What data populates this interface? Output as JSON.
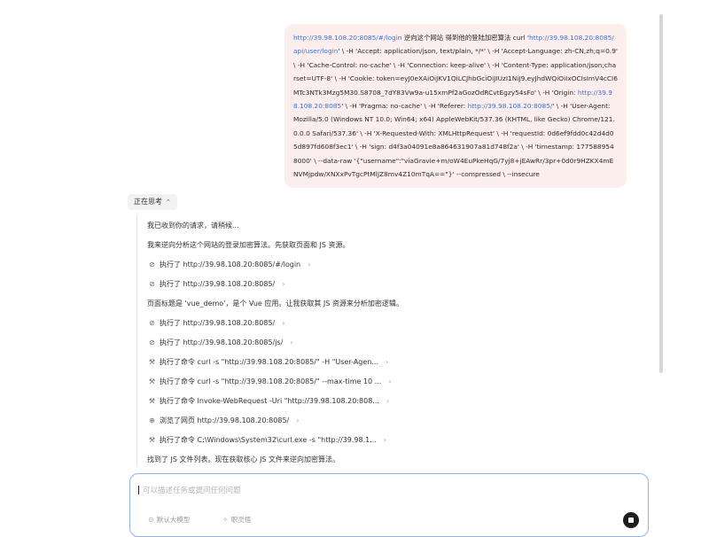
{
  "user_message": {
    "parts": [
      {
        "text": "http://39.98.108.20:8085/#/login",
        "link": true
      },
      {
        "text": " 逆向这个网站 得到他的登陆加密算法 curl '",
        "link": false
      },
      {
        "text": "http://39.98.108.20:8085/api/user/login",
        "link": true
      },
      {
        "text": "' \\ -H 'Accept: application/json, text/plain, */*' \\ -H 'Accept-Language: zh-CN,zh;q=0.9' \\ -H 'Cache-Control: no-cache' \\ -H 'Connection: keep-alive' \\ -H 'Content-Type: application/json;charset=UTF-8' \\ -H 'Cookie: token=eyJ0eXAiOiJKV1QiLCJhbGciOiJIUzI1NiJ9.eyJhdWQiOiIxOCIsImV4cCI6MTc3NTk3Mzg5M30.S8708_7dY83Vw9a-u15xmPf2aGozOdRCvtEgzy54sFo' \\ -H 'Origin: ",
        "link": false
      },
      {
        "text": "http://39.98.108.20:8085",
        "link": true
      },
      {
        "text": "' \\ -H 'Pragma: no-cache' \\ -H 'Referer: ",
        "link": false
      },
      {
        "text": "http://39.98.108.20:8085/",
        "link": true
      },
      {
        "text": "' \\ -H 'User-Agent: Mozilla/5.0 (Windows NT 10.0; Win64; x64) AppleWebKit/537.36 (KHTML, like Gecko) Chrome/121.0.0.0 Safari/537.36' \\ -H 'X-Requested-With: XMLHttpRequest' \\ -H 'requestId: 0d6ef9fdd0c42d4d05d897fd608f3ec1' \\ -H 'sign: d4f3a04091e8a864631907a81d748f2a' \\ -H 'timestamp: 1775889548000' \\ --data-raw '{\"username\":\"viaGravie+m/oW4EuPkeHqG/7yj8+jEAwRr/3pr+0d0r9HZKX4mENVMjpdw/XNXxPvTgcPtMlJZ8mv4Z10mTqA==\"}' --compressed \\ --insecure",
        "link": false
      }
    ]
  },
  "thinking": {
    "label": "正在思考",
    "chevron": "⌃"
  },
  "steps": [
    {
      "kind": "note",
      "text": "我已收到你的请求，请稍候..."
    },
    {
      "kind": "note",
      "text": "我来逆向分析这个网站的登录加密算法。先获取页面和 JS 资源。"
    },
    {
      "kind": "action",
      "icon": "link-icon",
      "glyph": "⊘",
      "text": "执行了 http://39.98.108.20:8085/#/login",
      "arrow": "›"
    },
    {
      "kind": "action",
      "icon": "link-icon",
      "glyph": "⊘",
      "text": "执行了 http://39.98.108.20:8085/",
      "arrow": "›"
    },
    {
      "kind": "note",
      "text": "页面标题是 'vue_demo'，是个 Vue 应用。让我获取其 JS 资源来分析加密逻辑。"
    },
    {
      "kind": "action",
      "icon": "link-icon",
      "glyph": "⊘",
      "text": "执行了 http://39.98.108.20:8085/",
      "arrow": "›"
    },
    {
      "kind": "action",
      "icon": "link-icon",
      "glyph": "⊘",
      "text": "执行了 http://39.98.108.20:8085/js/",
      "arrow": "›"
    },
    {
      "kind": "action",
      "icon": "wrench-icon",
      "glyph": "⚒",
      "text": "执行了命令 curl -s \"http://39.98.108.20:8085/\" -H \"User-Agen...",
      "arrow": "›"
    },
    {
      "kind": "action",
      "icon": "wrench-icon",
      "glyph": "⚒",
      "text": "执行了命令 curl -s \"http://39.98.108.20:8085/\" --max-time 10 ...",
      "arrow": "›"
    },
    {
      "kind": "action",
      "icon": "wrench-icon",
      "glyph": "⚒",
      "text": "执行了命令 Invoke-WebRequest -Uri \"http://39.98.108.20:808...",
      "arrow": "›"
    },
    {
      "kind": "action",
      "icon": "globe-icon",
      "glyph": "⊕",
      "text": "浏览了网页 http://39.98.108.20:8085/",
      "arrow": "›"
    },
    {
      "kind": "action",
      "icon": "wrench-icon",
      "glyph": "⚒",
      "text": "执行了命令 C:\\Windows\\System32\\curl.exe -s \"http://39.98.1...",
      "arrow": "›"
    },
    {
      "kind": "note",
      "text": "找到了 JS 文件列表。现在获取核心 JS 文件来逆向加密算法。"
    }
  ],
  "input": {
    "placeholder": "可以描述任务或提问任何问题",
    "model_pill": "默认大模型",
    "model_pill_icon": "⊙",
    "mode_pill": "职灵悟",
    "mode_pill_icon": "✧"
  },
  "colors": {
    "user_bubble": "#fdeeee",
    "link": "#3b74d9",
    "input_border": "#8fb3f0",
    "stop_button": "#1e1e1e"
  }
}
